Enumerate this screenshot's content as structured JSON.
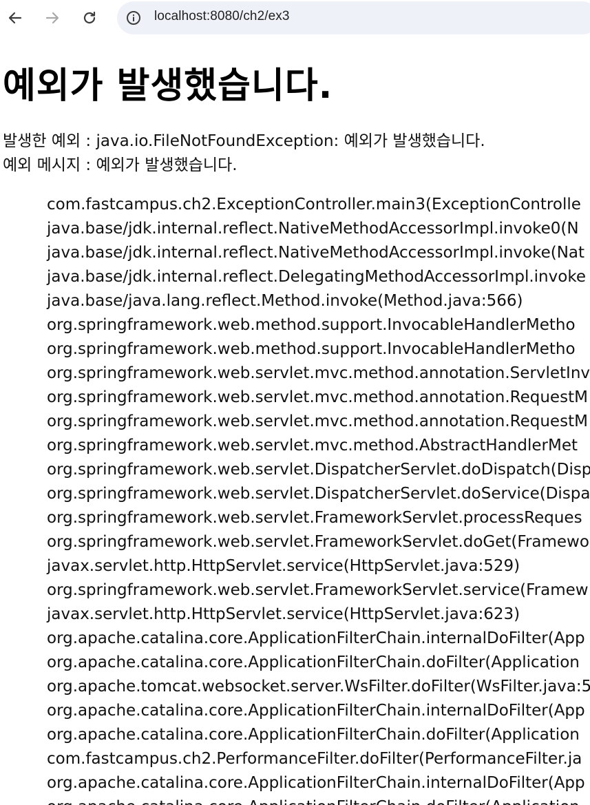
{
  "browser": {
    "url": "localhost:8080/ch2/ex3"
  },
  "page": {
    "title": "예외가 발생했습니다.",
    "exception_line": "발생한 예외 : java.io.FileNotFoundException: 예외가 발생했습니다.",
    "message_line": "예외 메시지 : 예외가 발생했습니다.",
    "stack_trace": [
      "com.fastcampus.ch2.ExceptionController.main3(ExceptionControlle",
      "java.base/jdk.internal.reflect.NativeMethodAccessorImpl.invoke0(N",
      "java.base/jdk.internal.reflect.NativeMethodAccessorImpl.invoke(Nat",
      "java.base/jdk.internal.reflect.DelegatingMethodAccessorImpl.invoke",
      "java.base/java.lang.reflect.Method.invoke(Method.java:566)",
      "org.springframework.web.method.support.InvocableHandlerMetho",
      "org.springframework.web.method.support.InvocableHandlerMetho",
      "org.springframework.web.servlet.mvc.method.annotation.ServletInv",
      "org.springframework.web.servlet.mvc.method.annotation.RequestM",
      "org.springframework.web.servlet.mvc.method.annotation.RequestM",
      "org.springframework.web.servlet.mvc.method.AbstractHandlerMet",
      "org.springframework.web.servlet.DispatcherServlet.doDispatch(Disp",
      "org.springframework.web.servlet.DispatcherServlet.doService(Dispa",
      "org.springframework.web.servlet.FrameworkServlet.processReques",
      "org.springframework.web.servlet.FrameworkServlet.doGet(Framewo",
      "javax.servlet.http.HttpServlet.service(HttpServlet.java:529)",
      "org.springframework.web.servlet.FrameworkServlet.service(Framew",
      "javax.servlet.http.HttpServlet.service(HttpServlet.java:623)",
      "org.apache.catalina.core.ApplicationFilterChain.internalDoFilter(App",
      "org.apache.catalina.core.ApplicationFilterChain.doFilter(Application",
      "org.apache.tomcat.websocket.server.WsFilter.doFilter(WsFilter.java:5",
      "org.apache.catalina.core.ApplicationFilterChain.internalDoFilter(App",
      "org.apache.catalina.core.ApplicationFilterChain.doFilter(Application",
      "com.fastcampus.ch2.PerformanceFilter.doFilter(PerformanceFilter.ja",
      "org.apache.catalina.core.ApplicationFilterChain.internalDoFilter(App",
      "org.apache.catalina.core.ApplicationFilterChain.doFilter(Application"
    ]
  }
}
